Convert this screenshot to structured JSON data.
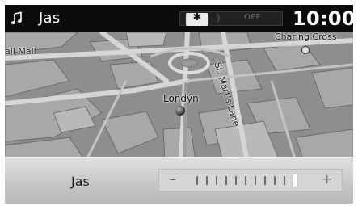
{
  "status_bar": {
    "source_title": "Jas",
    "music_icon": "music-note-icon",
    "brightness_glyph": "✱",
    "brightness_icon": "brightness-icon",
    "divider_glyph": "⟩",
    "display_off_label": "OFF",
    "clock": "10:00"
  },
  "map": {
    "labels": {
      "mall": "all Mall",
      "cross": "Charing Cross",
      "lane": "St. Mart's Lane",
      "city": "Londýn"
    }
  },
  "volume": {
    "label": "Jas",
    "minus": "–",
    "plus": "+",
    "ticks": 11,
    "level_index": 10
  }
}
